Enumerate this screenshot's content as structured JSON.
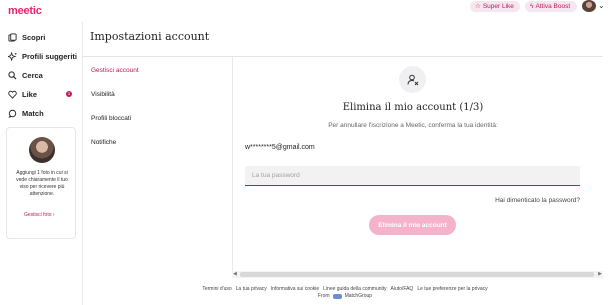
{
  "app": {
    "logo_text": "meetic"
  },
  "topbar": {
    "super_like_label": "Super Like",
    "boost_label": "Attiva Boost",
    "super_like_icon": "star-icon",
    "boost_icon": "lightning-icon"
  },
  "sidebar": {
    "items": [
      {
        "label": "Scopri",
        "icon": "discover-icon"
      },
      {
        "label": "Profili suggeriti",
        "icon": "sparkles-icon"
      },
      {
        "label": "Cerca",
        "icon": "search-icon"
      },
      {
        "label": "Like",
        "icon": "heart-icon",
        "badge": "1"
      },
      {
        "label": "Match",
        "icon": "chat-icon"
      }
    ],
    "promo": {
      "text": "Aggiungi 1 foto in cui si vede chiaramente il tuo viso per ricevere più attenzione.",
      "link": "Gestisci foto"
    }
  },
  "page": {
    "title": "Impostazioni account"
  },
  "settings_menu": [
    {
      "label": "Gestisci account",
      "active": true
    },
    {
      "label": "Visibilità",
      "active": false
    },
    {
      "label": "Profili bloccati",
      "active": false
    },
    {
      "label": "Notifiche",
      "active": false
    }
  ],
  "main": {
    "icon": "user-remove-icon",
    "title": "Elimina il mio account (1/3)",
    "subtitle": "Per annullare l'iscrizione a Meetic, conferma la tua identità:",
    "email": "w********5@gmail.com",
    "password_placeholder": "La tua password",
    "password_value": "",
    "forgot_label": "Hai dimenticato la password?",
    "delete_button_label": "Elimina il mio account"
  },
  "footer": {
    "links": [
      "Termini d'uso",
      "La tua privacy",
      "Informativa sui cookie",
      "Linee guida della community",
      "Aiuto/FAQ",
      "Le tue preferenze per la privacy"
    ],
    "from_label": "From",
    "brand": "MatchGroup"
  },
  "colors": {
    "accent": "#c2185b",
    "button_disabled": "#f4b3cb"
  }
}
